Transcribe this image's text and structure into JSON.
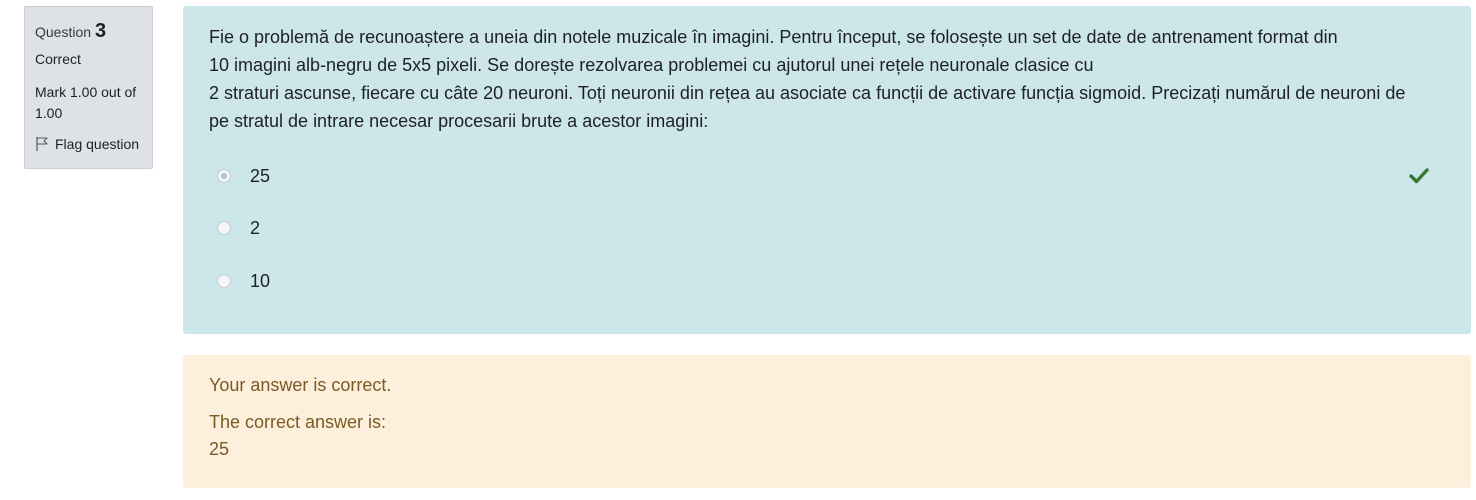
{
  "info": {
    "question_label": "Question",
    "question_number": "3",
    "state": "Correct",
    "grade": "Mark 1.00 out of 1.00",
    "flag_label": "Flag question"
  },
  "question": {
    "text": "Fie o problemă de recunoaștere a uneia din notele muzicale în imagini. Pentru început, se folosește un set de date de antrenament format din\n10 imagini alb-negru de 5x5 pixeli.  Se dorește rezolvarea problemei cu ajutorul unei rețele neuronale clasice cu\n2 straturi ascunse, fiecare cu câte 20 neuroni. Toți neuronii din rețea au asociate ca funcții de activare funcția sigmoid. Precizați numărul de neuroni de\npe stratul de intrare necesar procesarii brute a acestor imagini:",
    "answers": [
      {
        "label": "25",
        "selected": true,
        "correct": true
      },
      {
        "label": "2",
        "selected": false,
        "correct": false
      },
      {
        "label": "10",
        "selected": false,
        "correct": false
      }
    ],
    "correct_icon": "check-icon"
  },
  "outcome": {
    "feedback": "Your answer is correct.",
    "right_answer_title": "The correct answer is:",
    "right_answer_value": "25"
  },
  "colors": {
    "formulation_bg": "#cce6ea",
    "outcome_bg": "#fcefdc",
    "outcome_text": "#7a5a25",
    "correct_check": "#357a32",
    "info_bg": "#dee2e6"
  }
}
